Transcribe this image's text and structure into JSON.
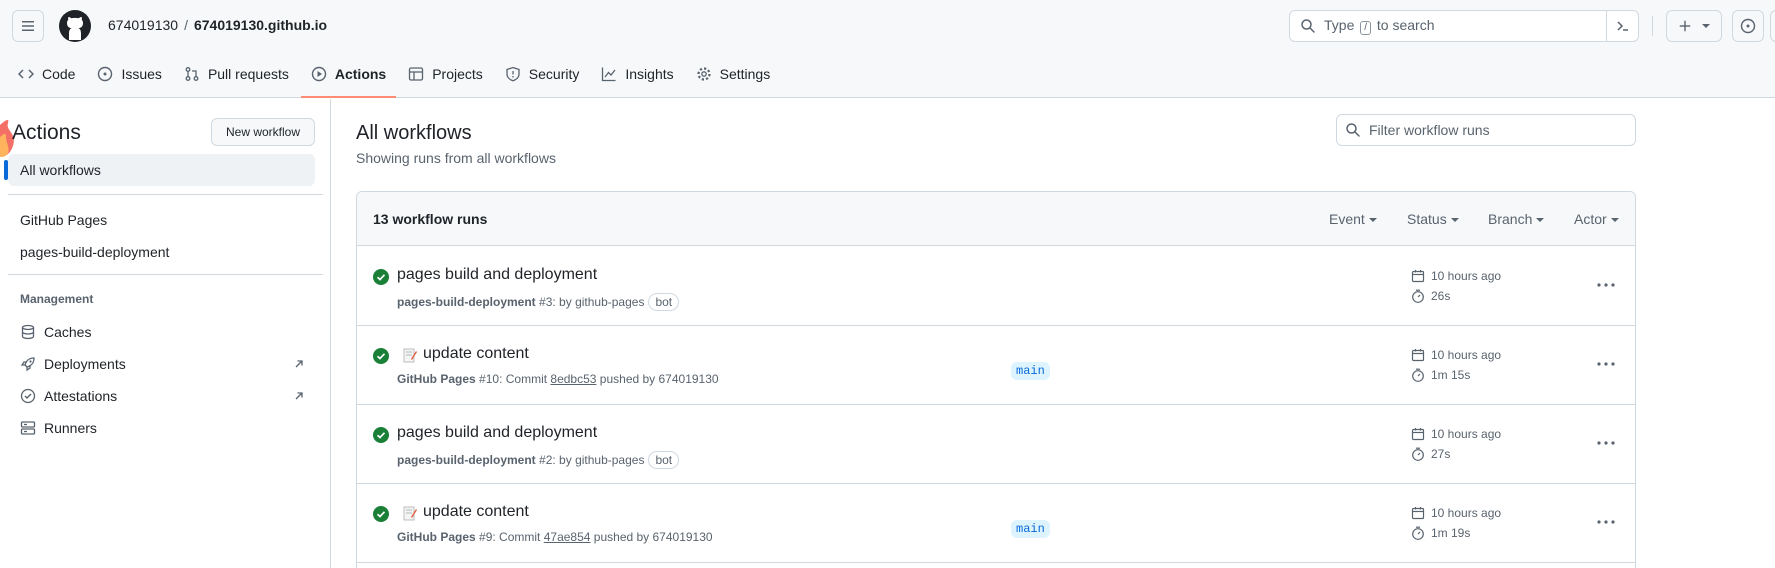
{
  "header": {
    "owner": "674019130",
    "separator": "/",
    "repo": "674019130.github.io",
    "search_prefix": "Type",
    "search_key": "/",
    "search_suffix": "to search"
  },
  "repo_nav": [
    {
      "label": "Code",
      "icon": "code-icon"
    },
    {
      "label": "Issues",
      "icon": "issue-icon"
    },
    {
      "label": "Pull requests",
      "icon": "pull-request-icon"
    },
    {
      "label": "Actions",
      "icon": "play-icon",
      "active": true
    },
    {
      "label": "Projects",
      "icon": "table-icon"
    },
    {
      "label": "Security",
      "icon": "shield-icon"
    },
    {
      "label": "Insights",
      "icon": "graph-icon"
    },
    {
      "label": "Settings",
      "icon": "gear-icon"
    }
  ],
  "sidebar": {
    "title": "Actions",
    "new_workflow": "New workflow",
    "all_workflows": "All workflows",
    "workflows": [
      "GitHub Pages",
      "pages-build-deployment"
    ],
    "management_heading": "Management",
    "management": [
      {
        "label": "Caches",
        "icon": "database-icon"
      },
      {
        "label": "Deployments",
        "icon": "rocket-icon",
        "external": true
      },
      {
        "label": "Attestations",
        "icon": "verified-icon",
        "external": true
      },
      {
        "label": "Runners",
        "icon": "server-icon"
      }
    ]
  },
  "main": {
    "title": "All workflows",
    "subtitle": "Showing runs from all workflows",
    "filter_placeholder": "Filter workflow runs",
    "runs_count": "13 workflow runs",
    "filters": [
      "Event",
      "Status",
      "Branch",
      "Actor"
    ]
  },
  "runs": [
    {
      "title": "pages build and deployment",
      "workflow": "pages-build-deployment",
      "number": "#3",
      "detail": ": by github-pages",
      "bot": "bot",
      "when": "10 hours ago",
      "duration": "26s"
    },
    {
      "title": "update content",
      "workflow": "GitHub Pages",
      "number": "#10",
      "commit_prefix": ": Commit",
      "sha": "8edbc53",
      "pushed": "pushed by 674019130",
      "branch": "main",
      "when": "10 hours ago",
      "duration": "1m 15s"
    },
    {
      "title": "pages build and deployment",
      "workflow": "pages-build-deployment",
      "number": "#2",
      "detail": ": by github-pages",
      "bot": "bot",
      "when": "10 hours ago",
      "duration": "27s"
    },
    {
      "title": "update content",
      "workflow": "GitHub Pages",
      "number": "#9",
      "commit_prefix": ": Commit",
      "sha": "47ae854",
      "pushed": "pushed by 674019130",
      "branch": "main",
      "when": "10 hours ago",
      "duration": "1m 19s"
    }
  ],
  "colors": {
    "accent": "#0969da",
    "success": "#1a7f37",
    "active_tab_underline": "#fd8c73",
    "border": "#d1d9e0"
  }
}
